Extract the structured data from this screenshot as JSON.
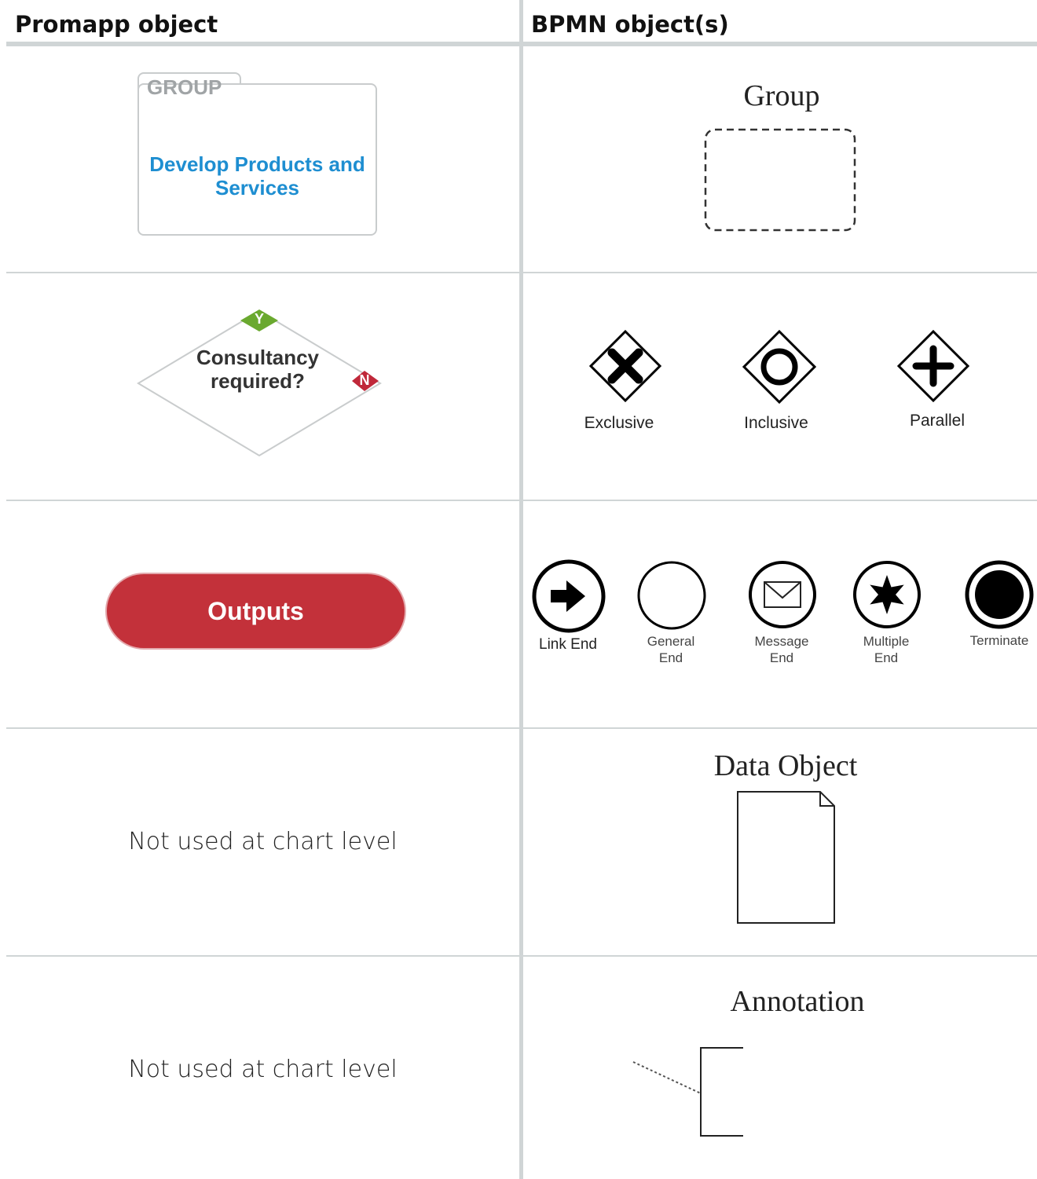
{
  "headers": {
    "left": "Promapp object",
    "right": "BPMN object(s)"
  },
  "rows": {
    "group": {
      "promapp_label": "GROUP",
      "promapp_name_line1": "Develop Products and",
      "promapp_name_line2": "Services",
      "bpmn_title": "Group"
    },
    "decision": {
      "question_line1": "Consultancy",
      "question_line2": "required?",
      "yes_badge": "Y",
      "no_badge": "N",
      "gateways": [
        "Exclusive",
        "Inclusive",
        "Parallel"
      ]
    },
    "outputs": {
      "button_label": "Outputs",
      "end_events": [
        {
          "line1": "Link End",
          "line2": ""
        },
        {
          "line1": "General",
          "line2": "End"
        },
        {
          "line1": "Message",
          "line2": "End"
        },
        {
          "line1": "Multiple",
          "line2": "End"
        },
        {
          "line1": "Terminate",
          "line2": ""
        }
      ]
    },
    "data_object": {
      "promapp_text": "Not used at chart level",
      "bpmn_title": "Data Object"
    },
    "annotation": {
      "promapp_text": "Not used at chart level",
      "bpmn_title": "Annotation"
    }
  },
  "colors": {
    "divider": "#d0d5d6",
    "link_blue": "#1e8ed1",
    "output_red": "#c3313a",
    "yes_green": "#6aa92f",
    "no_red": "#c0283a"
  }
}
